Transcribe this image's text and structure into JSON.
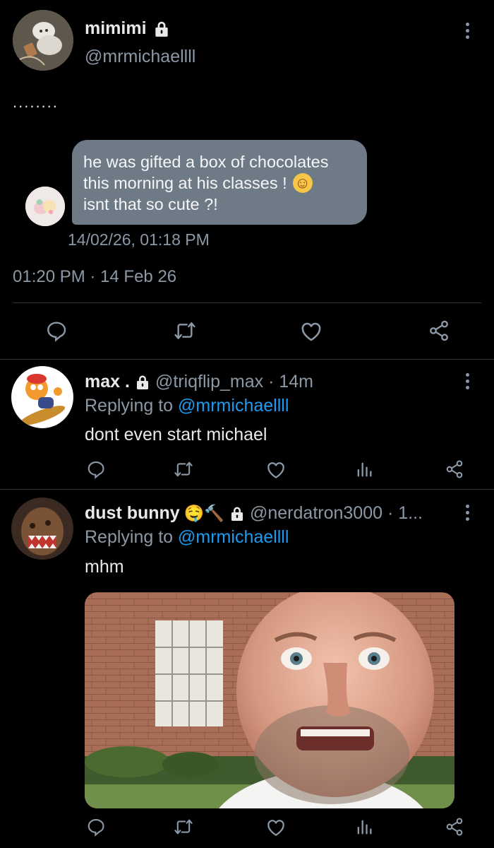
{
  "main_tweet": {
    "display_name": "mimimi",
    "handle": "@mrmichaellll",
    "text": "........",
    "message": {
      "line1": "he was gifted a box of chocolates",
      "line2": "this morning at his classes !",
      "line3": "isnt that so cute ?!",
      "emoji": "☺",
      "timestamp": "14/02/26, 01:18 PM"
    },
    "time": "01:20 PM · 14 Feb 26"
  },
  "replies": [
    {
      "display_name": "max .",
      "handle": "@triqflip_max · 14m",
      "replying_prefix": "Replying to",
      "replying_to": "@mrmichaellll",
      "text": "dont even start michael"
    },
    {
      "display_name": "dust bunny",
      "name_emojis": "🤤🔨",
      "handle": "@nerdatron3000 · 1...",
      "replying_prefix": "Replying to",
      "replying_to": "@mrmichaellll",
      "text": "mhm"
    }
  ],
  "icons": {
    "reply": "reply-icon",
    "retweet": "retweet-icon",
    "like": "heart-icon",
    "views": "analytics-icon",
    "share": "share-icon",
    "lock": "lock-icon",
    "more": "more-icon"
  },
  "colors": {
    "background": "#000000",
    "text": "#e7e9ea",
    "muted": "#8b98a5",
    "link": "#1d9bf0",
    "bubble": "#6e7b87",
    "divider": "#2f3336"
  }
}
